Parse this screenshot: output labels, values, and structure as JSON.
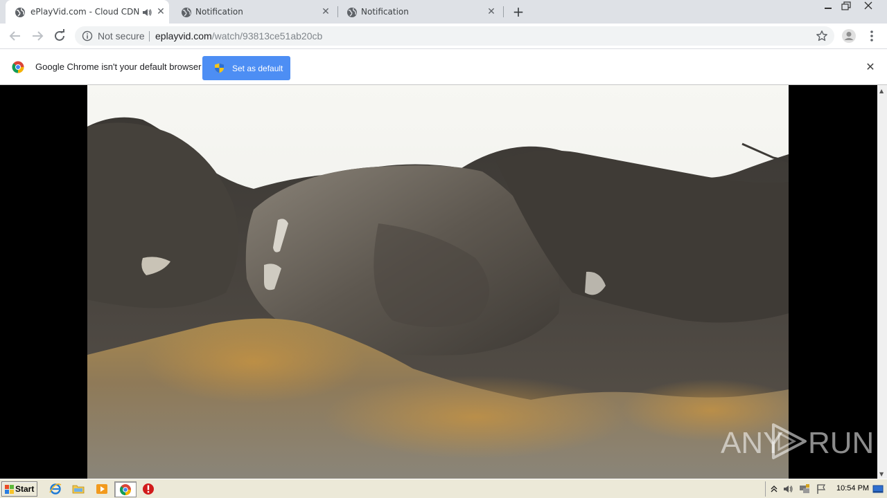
{
  "browser": {
    "tabs": [
      {
        "title": "ePlayVid.com - Cloud CDN",
        "active": true,
        "audio": true
      },
      {
        "title": "Notification",
        "active": false
      },
      {
        "title": "Notification",
        "active": false
      }
    ],
    "address": {
      "security_label": "Not secure",
      "host": "eplayvid.com",
      "path": "/watch/93813ce51ab20cb"
    }
  },
  "infobar": {
    "message": "Google Chrome isn't your default browser",
    "button_label": "Set as default"
  },
  "watermark": {
    "left": "ANY",
    "right": "RUN"
  },
  "taskbar": {
    "start_label": "Start",
    "clock": "10:54 PM"
  },
  "colors": {
    "accent_button": "#4d8ef4",
    "tabstrip": "#dee1e6",
    "taskbar": "#ece9d8"
  }
}
